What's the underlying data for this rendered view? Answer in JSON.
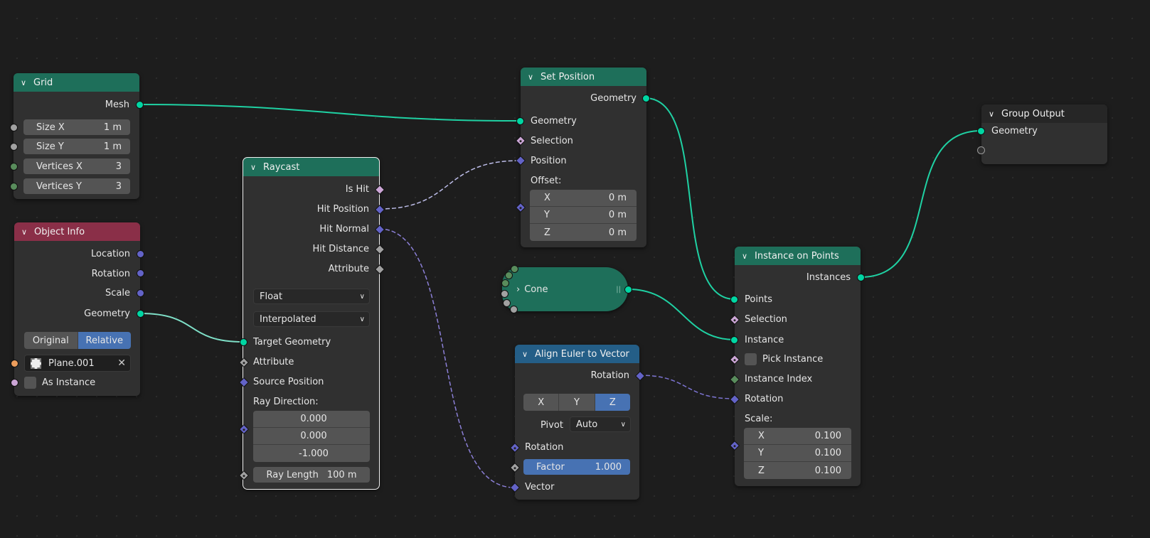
{
  "editor": "Geometry Node Editor",
  "colors": {
    "geometry_socket": "#00d6a3",
    "vector_socket": "#6363c7",
    "float_socket": "#a1a1a1",
    "int_socket": "#598c5c",
    "bool_socket": "#cca6d6",
    "object_socket": "#ed9e5c",
    "header_geometry": "#1e6f5a",
    "header_input": "#8a2f48",
    "header_converter": "#245e87",
    "active_blue": "#4772b3"
  },
  "nodes": {
    "grid": {
      "title": "Grid",
      "outputs": [
        "Mesh"
      ],
      "inputs": [
        {
          "label": "Size X",
          "value": "1 m"
        },
        {
          "label": "Size Y",
          "value": "1 m"
        },
        {
          "label": "Vertices X",
          "value": "3"
        },
        {
          "label": "Vertices Y",
          "value": "3"
        }
      ]
    },
    "object_info": {
      "title": "Object Info",
      "outputs": [
        "Location",
        "Rotation",
        "Scale",
        "Geometry"
      ],
      "transform_space": {
        "options": [
          "Original",
          "Relative"
        ],
        "selected": "Relative"
      },
      "object": "Plane.001",
      "as_instance": "As Instance"
    },
    "raycast": {
      "title": "Raycast",
      "outputs": [
        "Is Hit",
        "Hit Position",
        "Hit Normal",
        "Hit Distance",
        "Attribute"
      ],
      "data_type": "Float",
      "mapping": "Interpolated",
      "inputs": [
        "Target Geometry",
        "Attribute",
        "Source Position"
      ],
      "ray_direction_label": "Ray Direction:",
      "ray_direction": [
        "0.000",
        "0.000",
        "-1.000"
      ],
      "ray_length": {
        "label": "Ray Length",
        "value": "100 m"
      }
    },
    "set_position": {
      "title": "Set Position",
      "outputs": [
        "Geometry"
      ],
      "inputs": [
        "Geometry",
        "Selection",
        "Position"
      ],
      "offset_label": "Offset:",
      "offset": [
        {
          "axis": "X",
          "value": "0 m"
        },
        {
          "axis": "Y",
          "value": "0 m"
        },
        {
          "axis": "Z",
          "value": "0 m"
        }
      ]
    },
    "cone": {
      "title": "Cone",
      "collapsed": true
    },
    "align_euler": {
      "title": "Align Euler to Vector",
      "outputs": [
        "Rotation"
      ],
      "axis": {
        "options": [
          "X",
          "Y",
          "Z"
        ],
        "selected": "Z"
      },
      "pivot_label": "Pivot",
      "pivot": "Auto",
      "inputs": [
        "Rotation",
        "Vector"
      ],
      "factor": {
        "label": "Factor",
        "value": "1.000",
        "fraction": 1.0
      }
    },
    "instance_on_points": {
      "title": "Instance on Points",
      "outputs": [
        "Instances"
      ],
      "inputs": [
        "Points",
        "Selection",
        "Instance",
        "Pick Instance",
        "Instance Index",
        "Rotation"
      ],
      "scale_label": "Scale:",
      "scale": [
        {
          "axis": "X",
          "value": "0.100"
        },
        {
          "axis": "Y",
          "value": "0.100"
        },
        {
          "axis": "Z",
          "value": "0.100"
        }
      ]
    },
    "group_output": {
      "title": "Group Output",
      "inputs": [
        "Geometry"
      ]
    }
  }
}
